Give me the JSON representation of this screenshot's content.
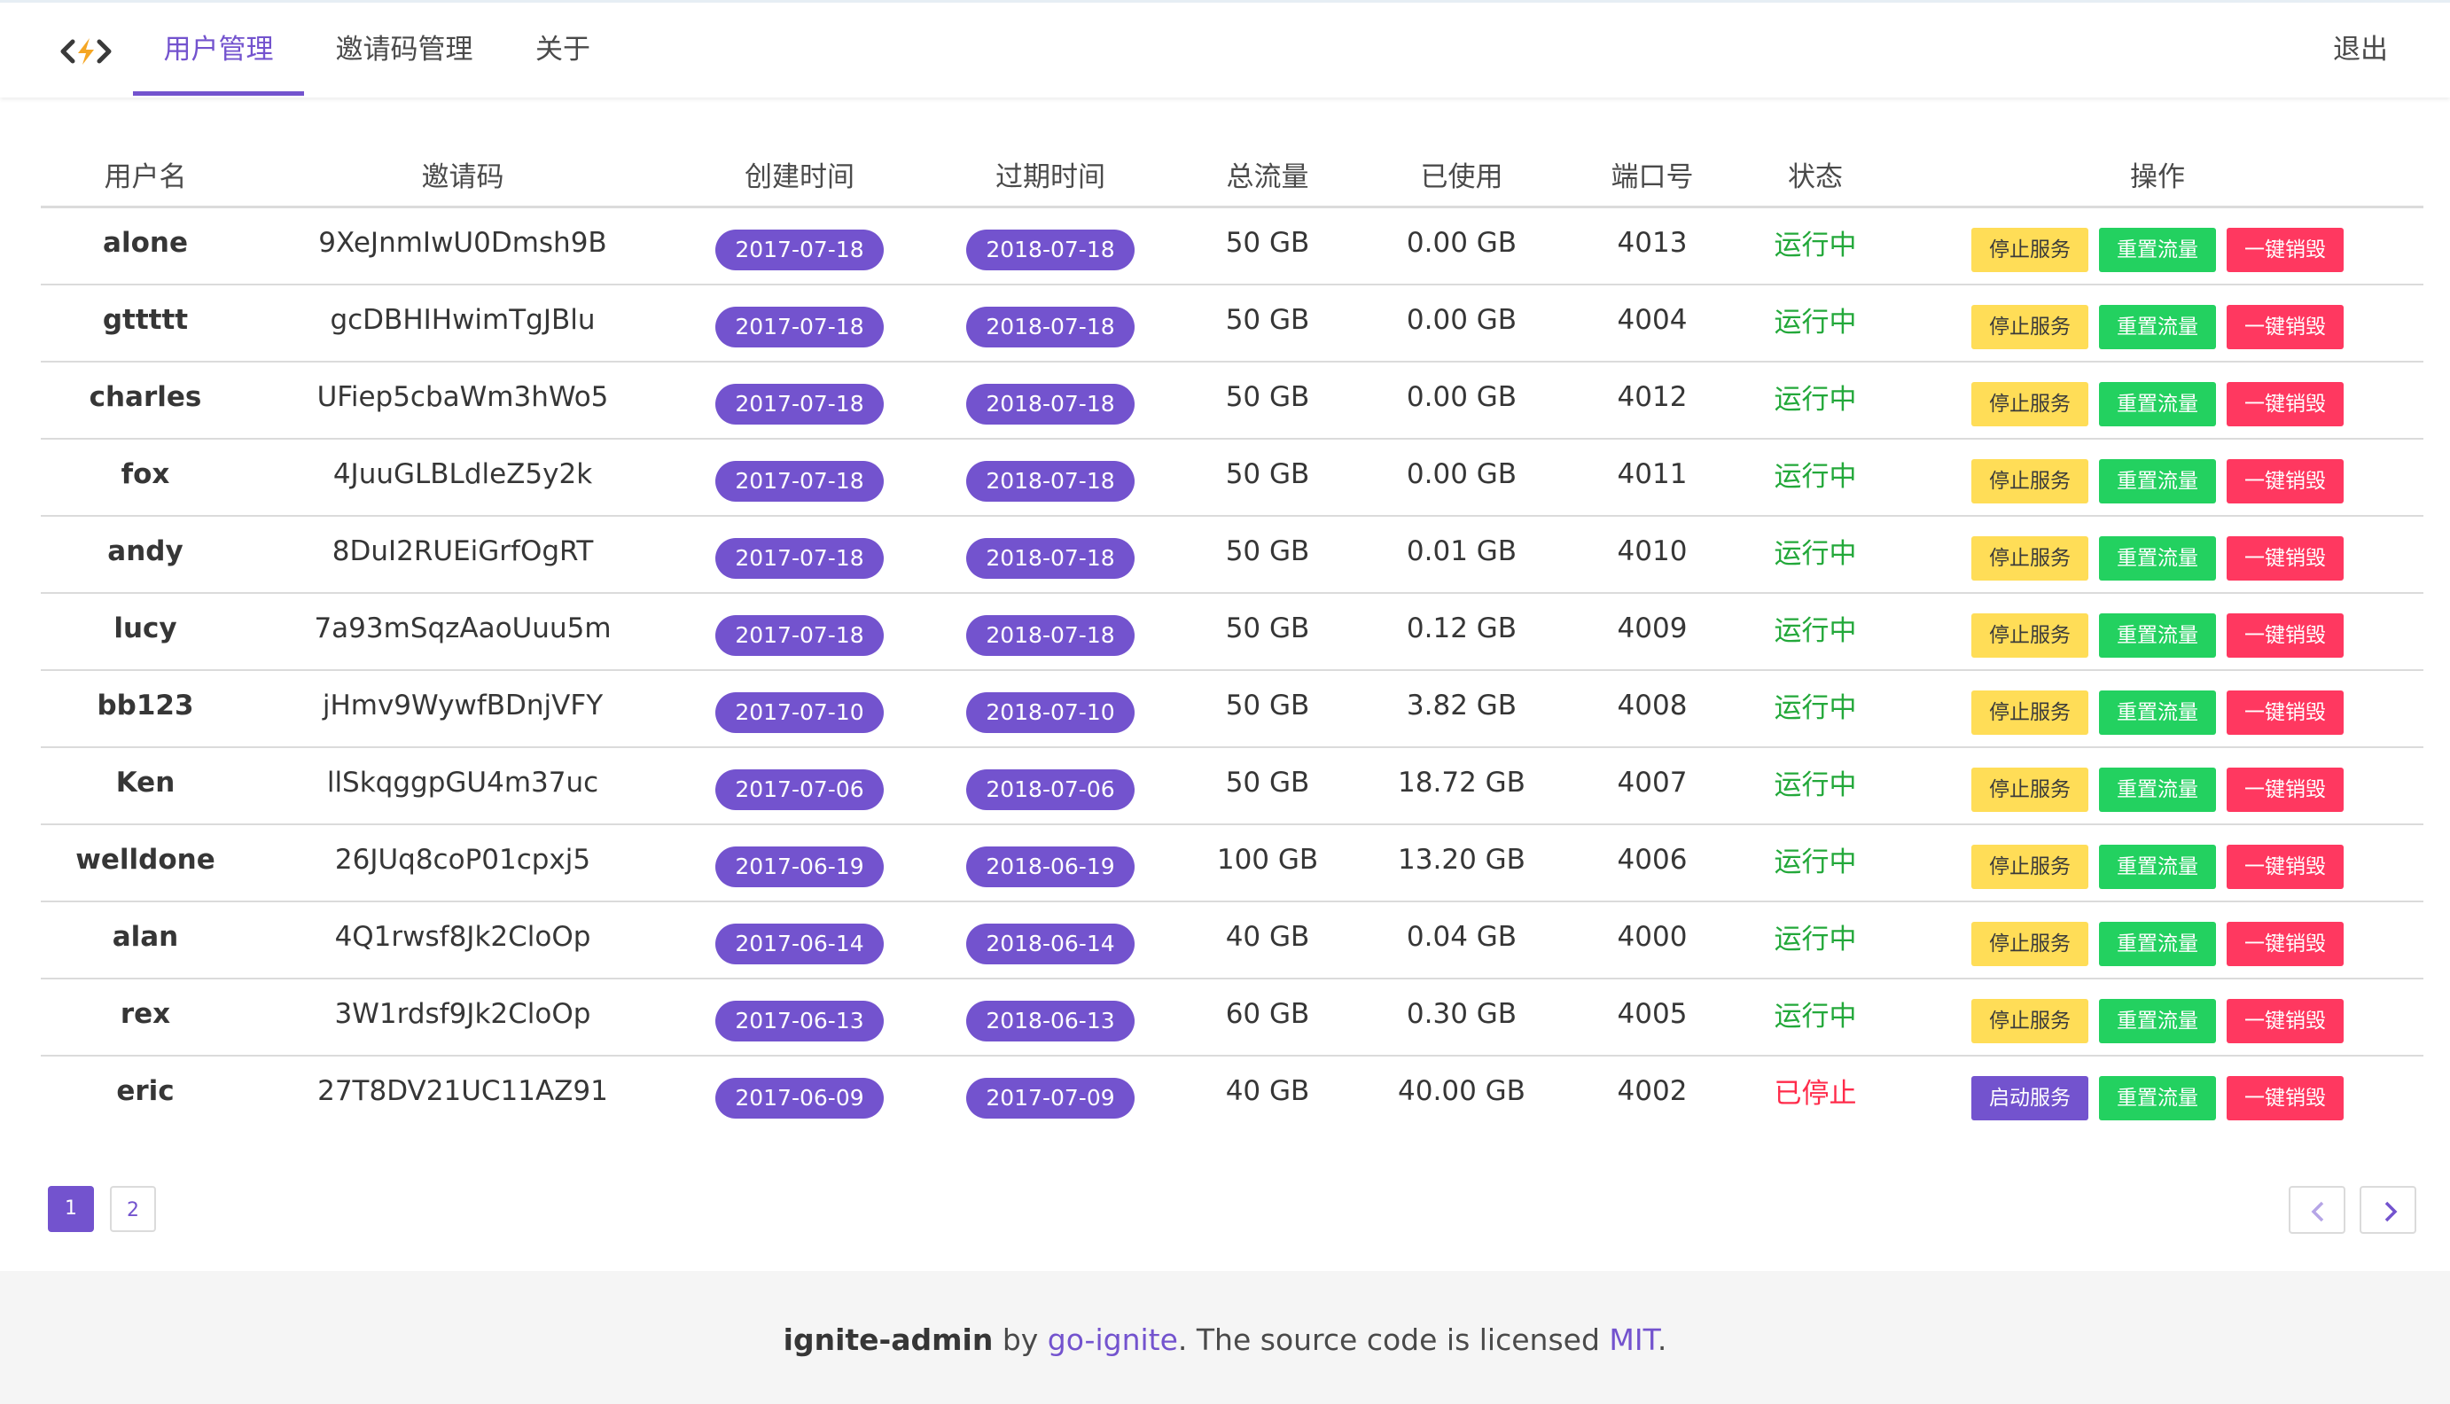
{
  "nav": {
    "tabs": [
      "用户管理",
      "邀请码管理",
      "关于"
    ],
    "active_tab": "用户管理",
    "logout": "退出"
  },
  "table": {
    "headers": [
      "用户名",
      "邀请码",
      "创建时间",
      "过期时间",
      "总流量",
      "已使用",
      "端口号",
      "状态",
      "操作"
    ],
    "rows": [
      {
        "name": "alone",
        "code": "9XeJnmIwU0Dmsh9B",
        "created": "2017-07-18",
        "expires": "2018-07-18",
        "total": "50 GB",
        "used": "0.00 GB",
        "port": "4013",
        "status": "运行中",
        "running": true
      },
      {
        "name": "gttttt",
        "code": "gcDBHIHwimTgJBlu",
        "created": "2017-07-18",
        "expires": "2018-07-18",
        "total": "50 GB",
        "used": "0.00 GB",
        "port": "4004",
        "status": "运行中",
        "running": true
      },
      {
        "name": "charles",
        "code": "UFiep5cbaWm3hWo5",
        "created": "2017-07-18",
        "expires": "2018-07-18",
        "total": "50 GB",
        "used": "0.00 GB",
        "port": "4012",
        "status": "运行中",
        "running": true
      },
      {
        "name": "fox",
        "code": "4JuuGLBLdleZ5y2k",
        "created": "2017-07-18",
        "expires": "2018-07-18",
        "total": "50 GB",
        "used": "0.00 GB",
        "port": "4011",
        "status": "运行中",
        "running": true
      },
      {
        "name": "andy",
        "code": "8DuI2RUEiGrfOgRT",
        "created": "2017-07-18",
        "expires": "2018-07-18",
        "total": "50 GB",
        "used": "0.01 GB",
        "port": "4010",
        "status": "运行中",
        "running": true
      },
      {
        "name": "lucy",
        "code": "7a93mSqzAaoUuu5m",
        "created": "2017-07-18",
        "expires": "2018-07-18",
        "total": "50 GB",
        "used": "0.12 GB",
        "port": "4009",
        "status": "运行中",
        "running": true
      },
      {
        "name": "bb123",
        "code": "jHmv9WywfBDnjVFY",
        "created": "2017-07-10",
        "expires": "2018-07-10",
        "total": "50 GB",
        "used": "3.82 GB",
        "port": "4008",
        "status": "运行中",
        "running": true
      },
      {
        "name": "Ken",
        "code": "llSkqggpGU4m37uc",
        "created": "2017-07-06",
        "expires": "2018-07-06",
        "total": "50 GB",
        "used": "18.72 GB",
        "port": "4007",
        "status": "运行中",
        "running": true
      },
      {
        "name": "welldone",
        "code": "26JUq8coP01cpxj5",
        "created": "2017-06-19",
        "expires": "2018-06-19",
        "total": "100 GB",
        "used": "13.20 GB",
        "port": "4006",
        "status": "运行中",
        "running": true
      },
      {
        "name": "alan",
        "code": "4Q1rwsf8Jk2CloOp",
        "created": "2017-06-14",
        "expires": "2018-06-14",
        "total": "40 GB",
        "used": "0.04 GB",
        "port": "4000",
        "status": "运行中",
        "running": true
      },
      {
        "name": "rex",
        "code": "3W1rdsf9Jk2CloOp",
        "created": "2017-06-13",
        "expires": "2018-06-13",
        "total": "60 GB",
        "used": "0.30 GB",
        "port": "4005",
        "status": "运行中",
        "running": true
      },
      {
        "name": "eric",
        "code": "27T8DV21UC11AZ91",
        "created": "2017-06-09",
        "expires": "2017-07-09",
        "total": "40 GB",
        "used": "40.00 GB",
        "port": "4002",
        "status": "已停止",
        "running": false
      }
    ]
  },
  "actions": {
    "stop": "停止服务",
    "start": "启动服务",
    "reset": "重置流量",
    "destroy": "一键销毁"
  },
  "pagination": {
    "pages": [
      "1",
      "2"
    ],
    "current": "1"
  },
  "footer": {
    "brand": "ignite-admin",
    "by": " by ",
    "author": "go-ignite",
    "middle": ". The source code is licensed ",
    "license": "MIT",
    "end": "."
  },
  "colors": {
    "accent": "#7353ce",
    "running": "#23a83a",
    "stopped": "#ff2b4a",
    "warning": "#ffdd57",
    "success": "#23d160",
    "danger": "#ff3860"
  }
}
